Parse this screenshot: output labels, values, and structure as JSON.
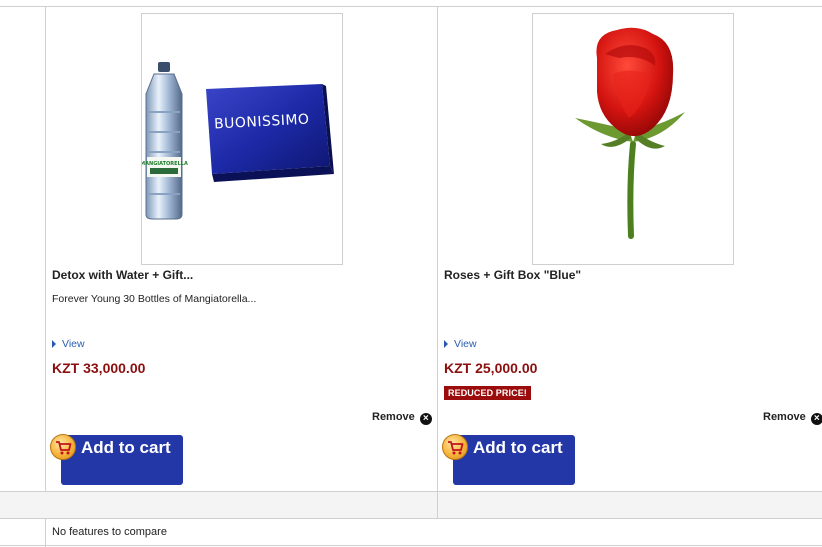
{
  "products": [
    {
      "title": "Detox with Water + Gift...",
      "description": "Forever Young 30 Bottles of Mangiatorella...",
      "view_label": "View",
      "price": "KZT 33,000.00",
      "badge": "",
      "remove_label": "Remove",
      "add_to_cart_label": "Add to cart",
      "image": {
        "icon": "water-bottle-and-gift-box",
        "box_brand": "BUONISSIMO",
        "bottle_brand": "MANGIATORELLA"
      }
    },
    {
      "title": "Roses + Gift Box \"Blue\"",
      "description": "",
      "view_label": "View",
      "price": "KZT 25,000.00",
      "badge": "REDUCED PRICE!",
      "remove_label": "Remove",
      "add_to_cart_label": "Add to cart",
      "image": {
        "icon": "red-rose"
      }
    }
  ],
  "features_text": "No features to compare",
  "colors": {
    "price": "#8b0f0f",
    "badge_bg": "#9b0d0d",
    "cart_button": "#2337a7",
    "link": "#2a5db0",
    "border": "#cfcfcf"
  }
}
